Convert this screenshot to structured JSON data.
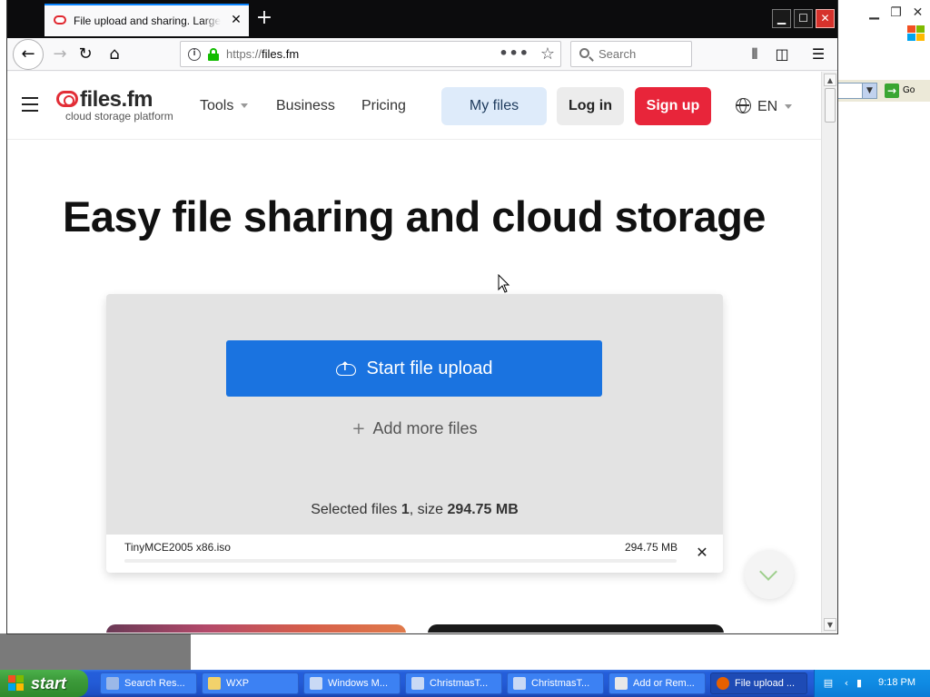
{
  "background_window": {
    "go_label": "Go"
  },
  "browser": {
    "tab_title": "File upload and sharing. Large file sharing",
    "url_scheme": "https://",
    "url_host": "files.fm",
    "search_placeholder": "Search"
  },
  "site": {
    "logo_name": "files.fm",
    "logo_tagline": "cloud storage platform",
    "nav": {
      "tools": "Tools",
      "business": "Business",
      "pricing": "Pricing"
    },
    "my_files": "My files",
    "log_in": "Log in",
    "sign_up": "Sign up",
    "language": "EN",
    "hero_title": "Easy file sharing and cloud storage",
    "upload": {
      "start_label": "Start file upload",
      "add_more_label": "Add more files",
      "selected_prefix": "Selected files ",
      "selected_count": "1",
      "size_prefix": ", size ",
      "selected_size": "294.75 MB"
    },
    "file": {
      "name": "TinyMCE2005 x86.iso",
      "size": "294.75 MB",
      "progress": 0
    }
  },
  "taskbar": {
    "start_label": "start",
    "items": [
      {
        "label": "Search Res..."
      },
      {
        "label": "WXP"
      },
      {
        "label": "Windows M..."
      },
      {
        "label": "ChristmasT..."
      },
      {
        "label": "ChristmasT..."
      },
      {
        "label": "Add or Rem..."
      },
      {
        "label": "File upload ..."
      }
    ],
    "clock": "9:18 PM"
  },
  "colors": {
    "primary_blue": "#1a73e0",
    "signup_red": "#e8253a",
    "logo_red": "#e22d36",
    "myfiles_bg": "#deebfa",
    "xp_taskbar": "#245edb"
  }
}
